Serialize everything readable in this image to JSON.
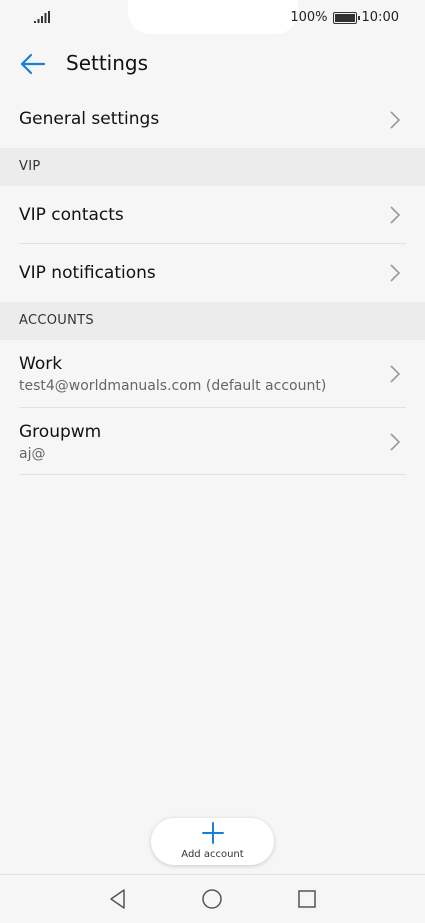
{
  "status_bar": {
    "battery_percent": "100%",
    "time": "10:00",
    "signal_icon": "signal-icon",
    "battery_icon": "battery-icon"
  },
  "app_bar": {
    "title": "Settings",
    "back_icon": "arrow-left-icon"
  },
  "rows": {
    "general": {
      "label": "General settings"
    },
    "vip_header": "VIP",
    "vip_contacts": {
      "label": "VIP contacts"
    },
    "vip_notifications": {
      "label": "VIP notifications"
    },
    "accounts_header": "ACCOUNTS",
    "work": {
      "name": "Work",
      "email": "test4@worldmanuals.com (default account)"
    },
    "groupwm": {
      "name": "Groupwm",
      "email": "aj@"
    }
  },
  "fab": {
    "label": "Add account",
    "icon": "plus-icon"
  },
  "nav_bar": {
    "back": "triangle-back-icon",
    "home": "circle-home-icon",
    "recents": "square-recents-icon"
  },
  "colors": {
    "accent": "#1a7fd4",
    "background": "#f6f6f6",
    "section_header_bg": "#ececec"
  }
}
